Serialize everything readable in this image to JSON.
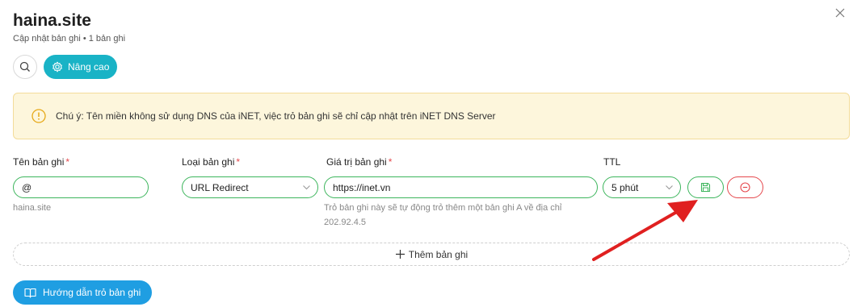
{
  "header": {
    "title": "haina.site",
    "subtitle": "Cập nhật bản ghi • 1 bản ghi"
  },
  "toolbar": {
    "advanced_label": "Nâng cao"
  },
  "alert": {
    "text": "Chú ý: Tên miền không sử dụng DNS của iNET, việc trỏ bản ghi sẽ chỉ cập nhật trên iNET DNS Server"
  },
  "form": {
    "name_label": "Tên bản ghi",
    "type_label": "Loại bản ghi",
    "value_label": "Giá trị bản ghi",
    "ttl_label": "TTL",
    "required_mark": "*",
    "name_value": "@",
    "name_hint": "haina.site",
    "type_value": "URL Redirect",
    "value_value": "https://inet.vn",
    "value_hint_line1": "Trỏ bản ghi này sẽ tự động trỏ thêm một bản ghi A về địa chỉ",
    "value_hint_line2": "202.92.4.5",
    "ttl_value": "5 phút"
  },
  "actions": {
    "add_record_label": "Thêm bản ghi",
    "guide_label": "Hướng dẫn trỏ bản ghi"
  },
  "colors": {
    "accent_teal": "#19b3c6",
    "accent_blue": "#1f9ee2",
    "success_green": "#3cb55c",
    "danger_red": "#e5484d",
    "annotation_arrow": "#e02020"
  },
  "icons": {
    "close": "close-icon",
    "search": "search-icon",
    "advanced": "gear-icon",
    "alert": "warning-circle-icon",
    "save": "save-icon",
    "remove": "minus-circle-icon",
    "add": "plus-icon",
    "guide": "book-icon",
    "dropdown": "chevron-down-icon"
  }
}
